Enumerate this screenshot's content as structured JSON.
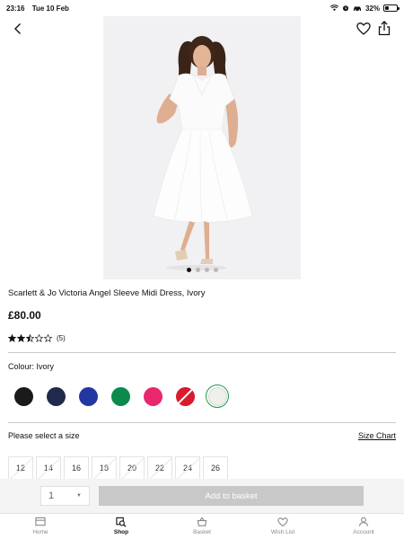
{
  "status_bar": {
    "time": "23:16",
    "date": "Tue 10 Feb",
    "battery": "32%",
    "battery_level": 0.32
  },
  "carousel": {
    "dot_count": 4,
    "active_index": 0
  },
  "product": {
    "title": "Scarlett & Jo Victoria Angel Sleeve Midi Dress, Ivory",
    "price": "£80.00",
    "rating": 2.5,
    "rating_max": 5,
    "review_count": "(5)"
  },
  "colour": {
    "label": "Colour: Ivory",
    "swatches": [
      {
        "color": "#1a1a1a",
        "available": true,
        "selected": false
      },
      {
        "color": "#1f2a4d",
        "available": true,
        "selected": false
      },
      {
        "color": "#2237a0",
        "available": true,
        "selected": false
      },
      {
        "color": "#0b8a4c",
        "available": true,
        "selected": false
      },
      {
        "color": "#e8276d",
        "available": true,
        "selected": false
      },
      {
        "color": "#d81b2f",
        "available": false,
        "selected": false
      },
      {
        "color": "#eef0ea",
        "available": true,
        "selected": true
      }
    ]
  },
  "size": {
    "label": "Please select a size",
    "chart_link": "Size Chart",
    "options": [
      {
        "label": "12",
        "available": false
      },
      {
        "label": "14",
        "available": false
      },
      {
        "label": "16",
        "available": true
      },
      {
        "label": "18",
        "available": false
      },
      {
        "label": "20",
        "available": false
      },
      {
        "label": "22",
        "available": false
      },
      {
        "label": "24",
        "available": false
      },
      {
        "label": "26",
        "available": true
      }
    ]
  },
  "basket": {
    "quantity": "1",
    "button": "Add to basket"
  },
  "tabs": [
    {
      "label": "Home",
      "icon": "home-icon",
      "active": false
    },
    {
      "label": "Shop",
      "icon": "shop-search-icon",
      "active": true
    },
    {
      "label": "Basket",
      "icon": "basket-icon",
      "active": false
    },
    {
      "label": "Wish List",
      "icon": "heart-icon",
      "active": false
    },
    {
      "label": "Account",
      "icon": "account-icon",
      "active": false
    }
  ]
}
